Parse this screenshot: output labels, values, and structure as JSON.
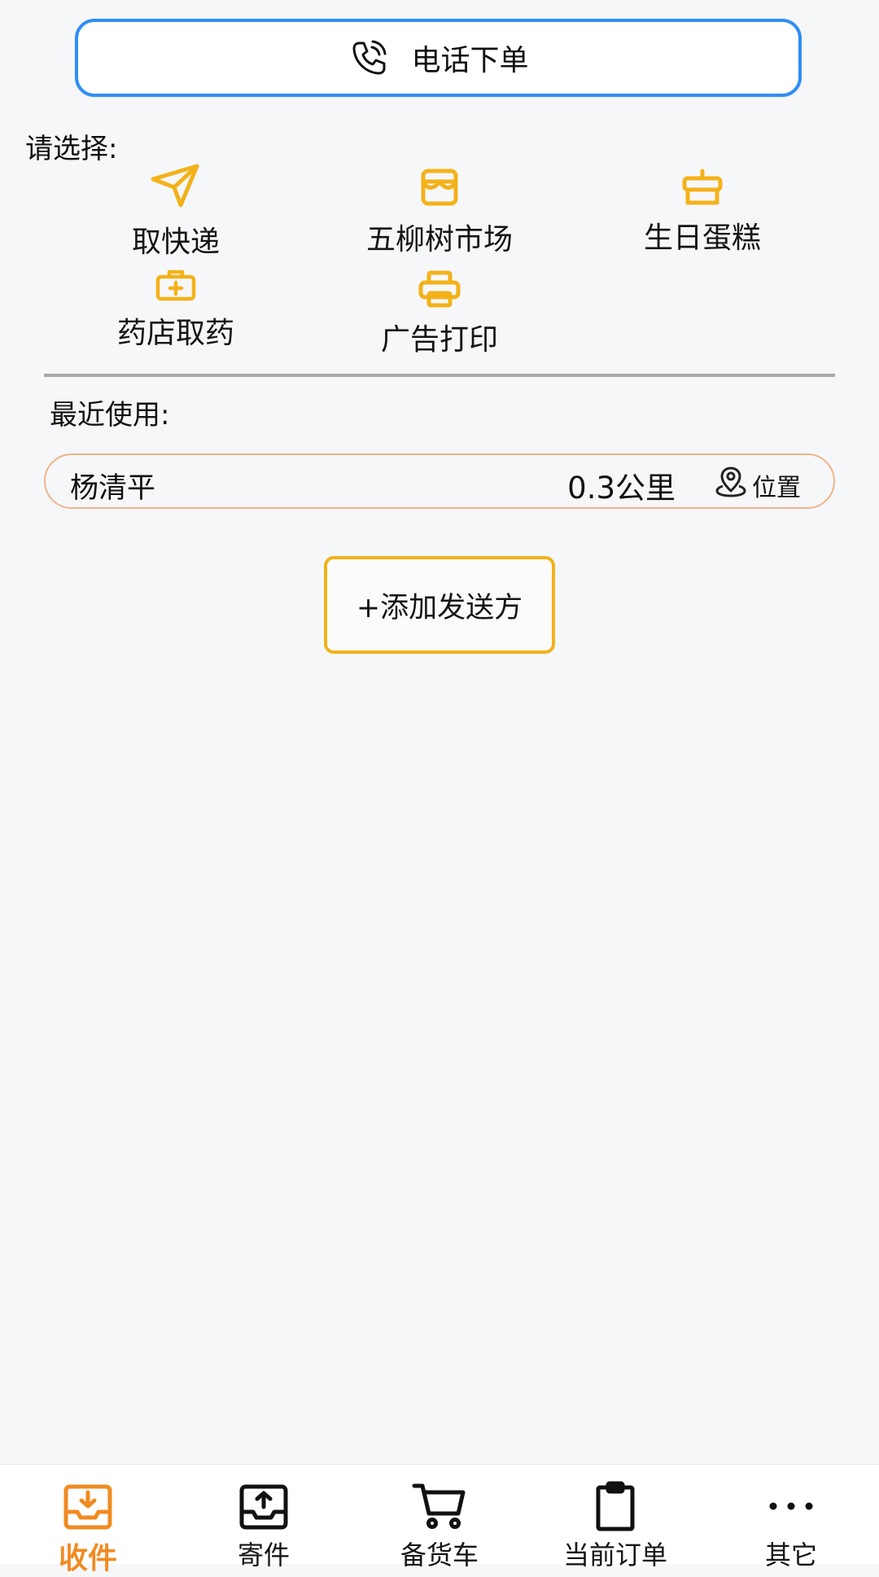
{
  "phone_order": {
    "label": "电话下单",
    "icon": "phone-call-icon"
  },
  "choose_section": {
    "title": "请选择:"
  },
  "categories": [
    {
      "label": "取快递",
      "icon": "paper-plane-icon"
    },
    {
      "label": "五柳树市场",
      "icon": "storefront-icon"
    },
    {
      "label": "生日蛋糕",
      "icon": "cake-icon"
    },
    {
      "label": "药店取药",
      "icon": "medicine-box-icon"
    },
    {
      "label": "广告打印",
      "icon": "printer-icon"
    }
  ],
  "recent_section": {
    "title": "最近使用:"
  },
  "recent_items": [
    {
      "name": "杨清平",
      "distance": "0.3公里",
      "location_label": "位置"
    }
  ],
  "add_sender": {
    "label": "+添加发送方"
  },
  "tabbar": {
    "items": [
      {
        "label": "收件",
        "icon": "inbox-download-icon",
        "active": true
      },
      {
        "label": "寄件",
        "icon": "inbox-upload-icon",
        "active": false
      },
      {
        "label": "备货车",
        "icon": "cart-icon",
        "active": false
      },
      {
        "label": "当前订单",
        "icon": "clipboard-icon",
        "active": false
      },
      {
        "label": "其它",
        "icon": "more-dots-icon",
        "active": false
      }
    ]
  },
  "colors": {
    "accent_orange": "#f08b22",
    "icon_yellow": "#f3b21a",
    "phone_border_blue": "#2f8ef4",
    "recent_border": "#f0b38a"
  }
}
